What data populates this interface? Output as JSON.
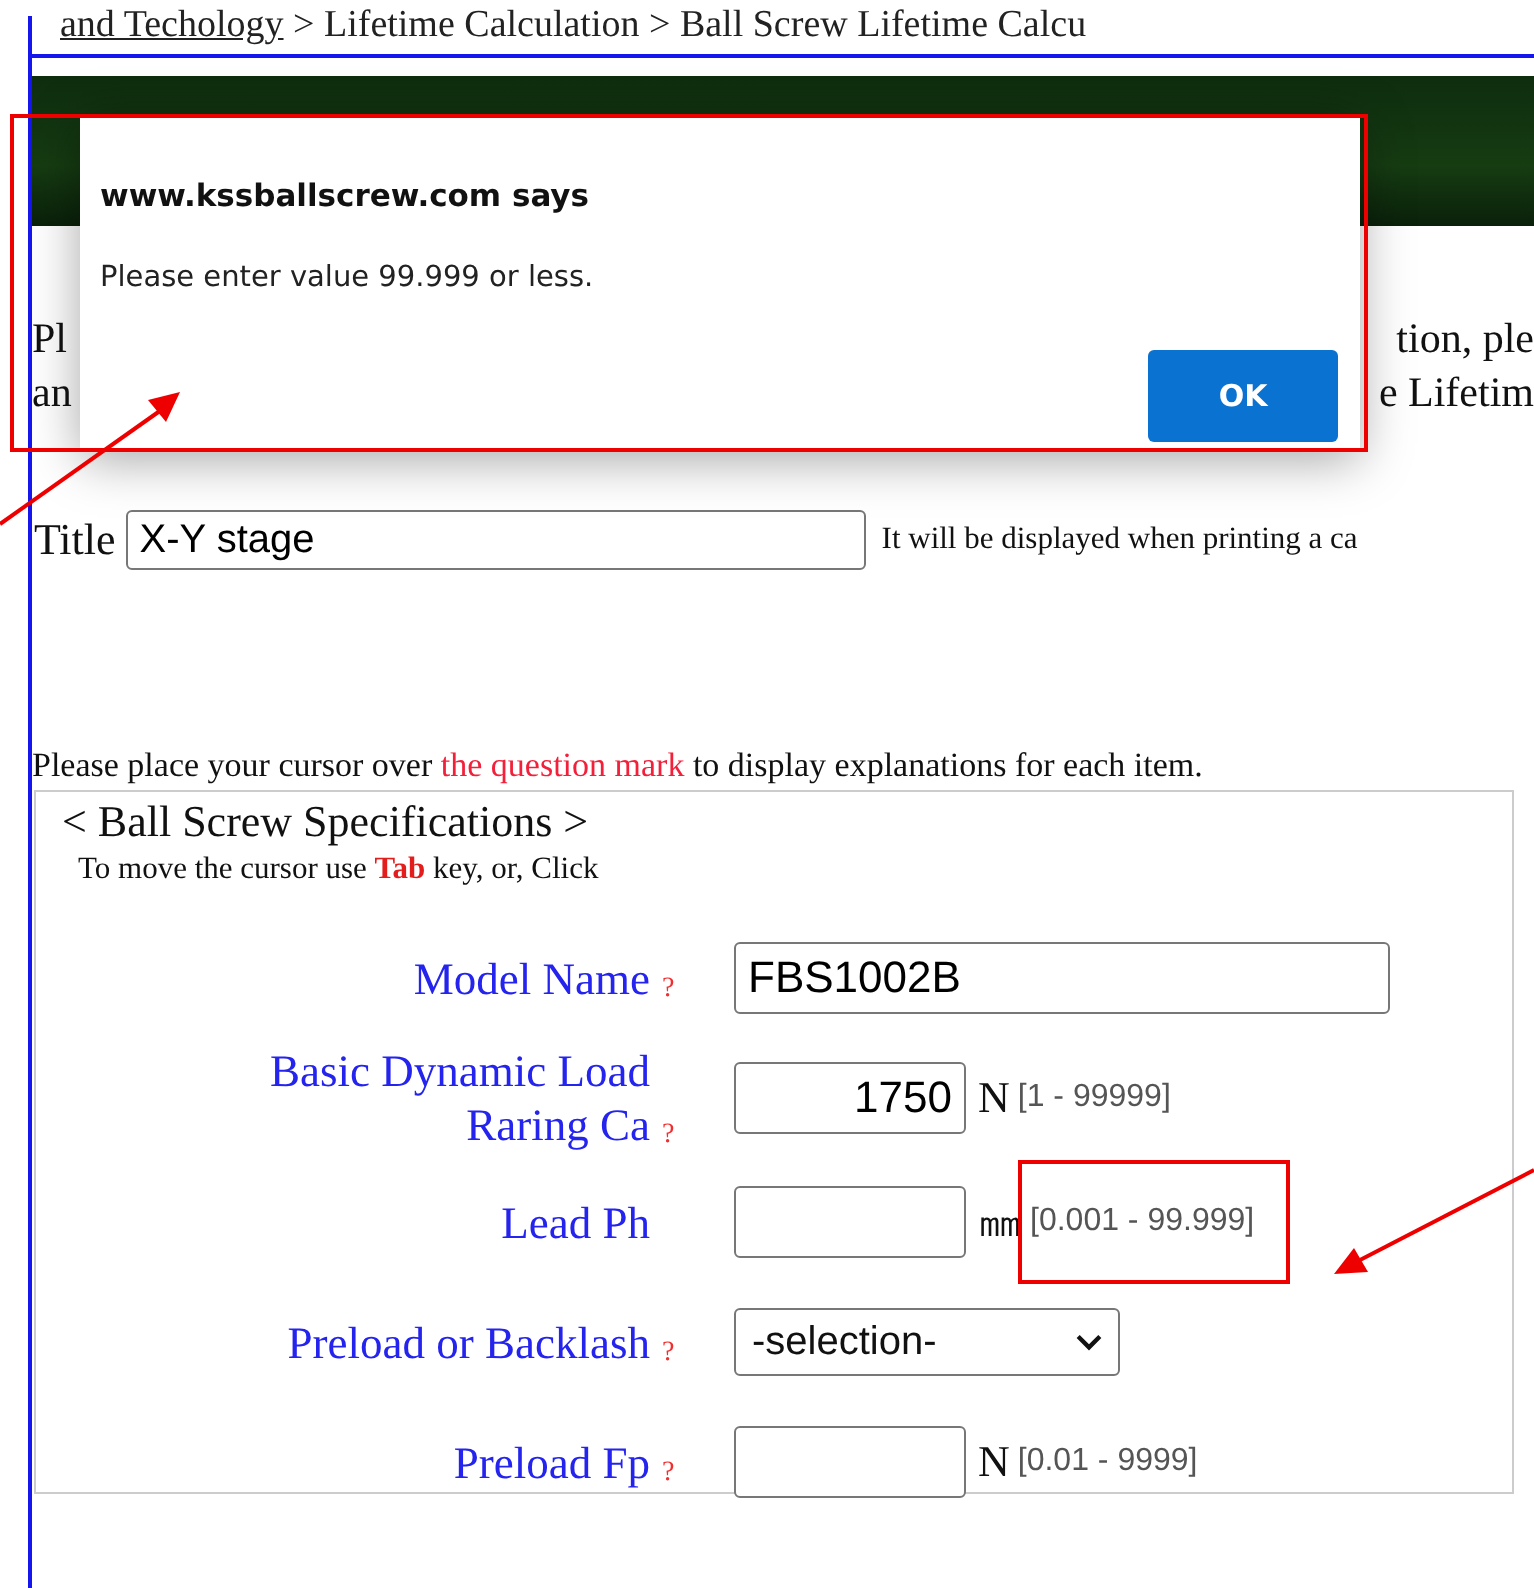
{
  "breadcrumb": {
    "link": "and Techology",
    "rest": " >  Lifetime Calculation >  Ball Screw Lifetime Calcu"
  },
  "intro": {
    "line_1_start": "Pl",
    "line_1_end": "tion, ple",
    "line_2_start": "an",
    "line_2_end": "e Lifetim"
  },
  "title_field": {
    "label": "Title",
    "value": "X-Y stage",
    "hint": "It will be displayed when printing a ca"
  },
  "instruction": [
    {
      "text": "Please place your cursor over ",
      "highlighted": false
    },
    {
      "text": "the question mark",
      "highlighted": true
    },
    {
      "text": " to display explanations for each item.",
      "highlighted": false
    }
  ],
  "specs": {
    "legend": "< Ball Screw Specifications >",
    "note": "To move the cursor use **Tab** key, or, Click",
    "rows": [
      {
        "kind": "text",
        "label": "Model Name",
        "help": "?",
        "value": "FBS1002B"
      },
      {
        "kind": "number",
        "label": "Basic Dynamic Load Raring  Ca",
        "help": "?",
        "value": "1750",
        "unit": "N",
        "range": "[1 - 99999]",
        "annotated": false
      },
      {
        "kind": "number",
        "label": "Lead  Ph",
        "value": "",
        "unit": "㎜",
        "range": "[0.001 - 99.999]",
        "annotated": true
      },
      {
        "kind": "select",
        "label": "Preload or Backlash",
        "help": "?",
        "value": "-selection-"
      },
      {
        "kind": "number",
        "label": "Preload  Fp",
        "help": "?",
        "value": "",
        "unit": "N",
        "range": "[0.01 - 9999]",
        "annotated": false
      }
    ]
  },
  "dialog": {
    "title": "www.kssballscrew.com says",
    "message": "Please enter value 99.999 or less.",
    "button": "OK",
    "annotated": true
  }
}
